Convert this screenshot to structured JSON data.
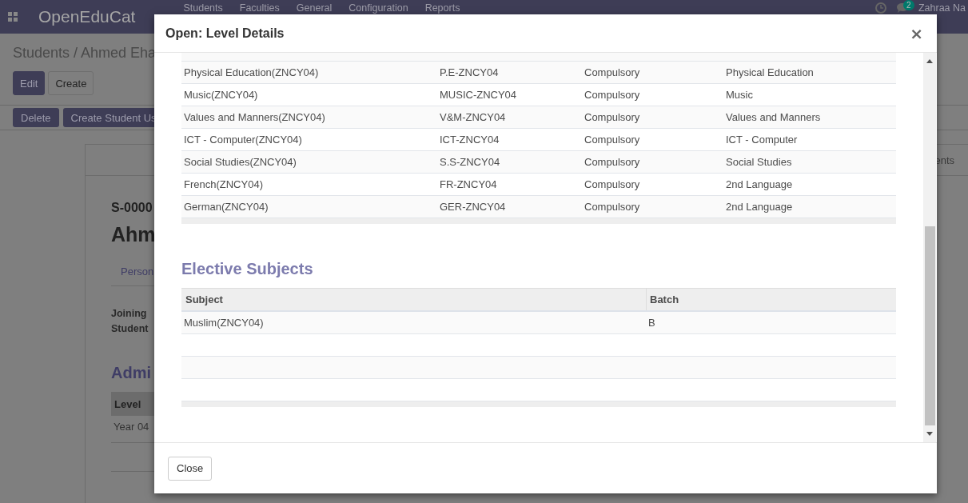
{
  "topbar": {
    "brand": "OpenEduCat",
    "menu": [
      "Students",
      "Faculties",
      "General",
      "Configuration",
      "Reports"
    ],
    "notification_count": "2",
    "user": "Zahraa Na"
  },
  "background": {
    "breadcrumb": "Students / Ahmed Eha",
    "buttons": [
      "Edit",
      "Create"
    ],
    "actions": [
      "Delete",
      "Create Student Us"
    ],
    "record_code": "S-0000",
    "record_name": "Ahm",
    "tab": "Person",
    "fields": [
      "Joining",
      "Student"
    ],
    "section": "Admi",
    "table_header": "Level",
    "table_cell": "Year 04",
    "right_tab": "ents"
  },
  "dialog": {
    "title": "Open: Level Details",
    "close_glyph": "×",
    "subjects": [
      {
        "subject": "Physical Education(ZNCY04)",
        "code": "P.E-ZNCY04",
        "type": "Compulsory",
        "category": "Physical Education"
      },
      {
        "subject": "Music(ZNCY04)",
        "code": "MUSIC-ZNCY04",
        "type": "Compulsory",
        "category": "Music"
      },
      {
        "subject": "Values and Manners(ZNCY04)",
        "code": "V&M-ZNCY04",
        "type": "Compulsory",
        "category": "Values and Manners"
      },
      {
        "subject": "ICT - Computer(ZNCY04)",
        "code": "ICT-ZNCY04",
        "type": "Compulsory",
        "category": "ICT - Computer"
      },
      {
        "subject": "Social Studies(ZNCY04)",
        "code": "S.S-ZNCY04",
        "type": "Compulsory",
        "category": "Social Studies"
      },
      {
        "subject": "French(ZNCY04)",
        "code": "FR-ZNCY04",
        "type": "Compulsory",
        "category": "2nd Language"
      },
      {
        "subject": "German(ZNCY04)",
        "code": "GER-ZNCY04",
        "type": "Compulsory",
        "category": "2nd Language"
      }
    ],
    "elective_title": "Elective Subjects",
    "elective_columns": [
      "Subject",
      "Batch"
    ],
    "elective_rows": [
      {
        "subject": "Muslim(ZNCY04)",
        "batch": "B"
      }
    ],
    "buttons": [
      "Close"
    ]
  }
}
